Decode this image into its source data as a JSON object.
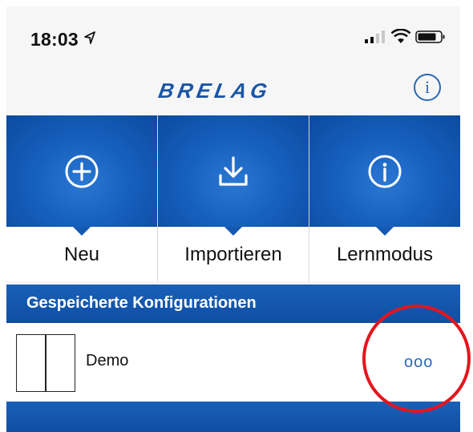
{
  "status_bar": {
    "time": "18:03"
  },
  "nav": {
    "logo_text": "BRELAG",
    "info_icon": "info-icon"
  },
  "tiles": [
    {
      "label": "Neu",
      "icon": "plus-circle-icon"
    },
    {
      "label": "Importieren",
      "icon": "download-icon"
    },
    {
      "label": "Lernmodus",
      "icon": "info-circle-icon"
    }
  ],
  "section": {
    "title": "Gespeicherte Konfigurationen"
  },
  "configurations": [
    {
      "name": "Demo",
      "more_label": "ooo"
    }
  ],
  "colors": {
    "brand_blue": "#1660bd",
    "highlight_red": "#e5151d",
    "accent": "#2a68b8"
  }
}
